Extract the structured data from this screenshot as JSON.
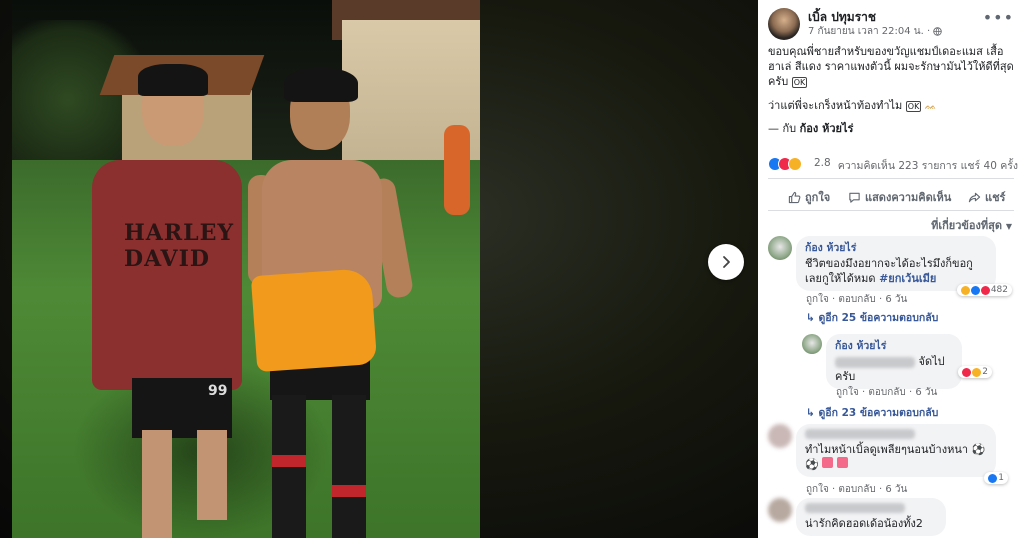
{
  "viewer": {
    "photo_shirt_text": "HARLEY\nDAVID",
    "photo_shorts_number": "99"
  },
  "post": {
    "author": "เบิ้ล ปทุมราช",
    "timestamp": "7 กันยายน เวลา 22:04 น.",
    "privacy_icon": "globe-icon",
    "text_line1": "ขอบคุณพี่ชายสำหรับของขวัญแชมป์เดอะแมส เสื้อ ฮาเล่ สีแดง ราคาแพงตัวนี้ ผมจะรักษามันไว้ให้ดีที่สุดครับ",
    "text_emoji1": "OK",
    "text_line2": "ว่าแต่พี่จะเกร็งหน้าท้องทำไม",
    "text_emoji2": "OK",
    "with_prefix": "— กับ",
    "with_name": "ก้อง ห้วยไร่"
  },
  "stats": {
    "reaction_count": "2.8",
    "comments_shares": "ความคิดเห็น 223 รายการ  แชร์ 40 ครั้ง"
  },
  "actions": {
    "like": "ถูกใจ",
    "comment": "แสดงความคิดเห็น",
    "share": "แชร์"
  },
  "sort_label": "ที่เกี่ยวข้องที่สุด",
  "comments": [
    {
      "name": "ก้อง ห้วยไร่",
      "text": "ชีวิตของมึงอยากจะได้อะไรมึงก็ขอกูเลยกูให้ได้หมด",
      "hashtag": "#ยกเว้นเมีย",
      "reaction_count": "482",
      "like": "ถูกใจ",
      "reply": "ตอบกลับ",
      "time": "6 วัน",
      "replies_link": "ดูอีก 25 ข้อความตอบกลับ"
    },
    {
      "name": "ก้อง ห้วยไร่",
      "text_tail": "จัดไป",
      "text_line2": "ครับ",
      "reaction_count": "2",
      "like": "ถูกใจ",
      "reply": "ตอบกลับ",
      "time": "6 วัน",
      "replies_link": "ดูอีก 23 ข้อความตอบกลับ"
    },
    {
      "text": "ทำไมหน้าเบิ้ลดูเพลียๆนอนบ้างหนา",
      "reaction_count": "1",
      "like": "ถูกใจ",
      "reply": "ตอบกลับ",
      "time": "6 วัน"
    },
    {
      "text": "น่ารักคิดฮอดเด้อน้องทั้ง2"
    }
  ],
  "colors": {
    "link": "#385898",
    "like_blue": "#1877f2",
    "love_red": "#f0284a",
    "haha_yellow": "#f7b125"
  }
}
